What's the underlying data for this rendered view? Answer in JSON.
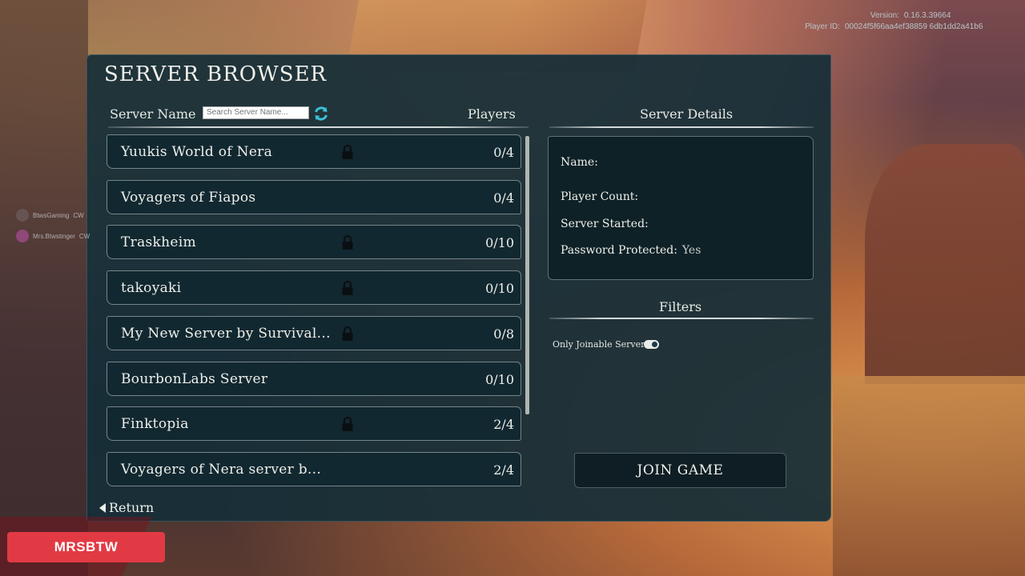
{
  "version": {
    "label": "Version:",
    "value": "0.16.3.39664",
    "player_label": "Player ID:",
    "player_value": "00024f5f66aa4ef38859 6db1dd2a41b6"
  },
  "title": "SERVER BROWSER",
  "list_header": {
    "name": "Server Name",
    "search_placeholder": "Search Server Name...",
    "players": "Players"
  },
  "servers": [
    {
      "name": "Yuukis World of Nera",
      "players": "0/4",
      "locked": true
    },
    {
      "name": "Voyagers of Fiapos",
      "players": "0/4",
      "locked": false
    },
    {
      "name": "Traskheim",
      "players": "0/10",
      "locked": true
    },
    {
      "name": "takoyaki",
      "players": "0/10",
      "locked": true
    },
    {
      "name": "My New Server by Survival...",
      "players": "0/8",
      "locked": true
    },
    {
      "name": "BourbonLabs Server",
      "players": "0/10",
      "locked": false
    },
    {
      "name": "Finktopia",
      "players": "2/4",
      "locked": true
    },
    {
      "name": "Voyagers of Nera server b...",
      "players": "2/4",
      "locked": false
    }
  ],
  "details": {
    "heading": "Server Details",
    "name_label": "Name:",
    "player_count_label": "Player Count:",
    "started_label": "Server Started:",
    "password_label": "Password Protected:",
    "password_value": "Yes"
  },
  "filters": {
    "heading": "Filters",
    "only_joinable": "Only Joinable Servers",
    "only_joinable_on": true
  },
  "join_button": "JOIN GAME",
  "return_label": "Return",
  "overlay": {
    "user1": "BtwsGaming",
    "user2": "Mrs.Btwstinger",
    "tag": "CW",
    "badge": "MRSBTW"
  },
  "colors": {
    "panel": "#162e38",
    "badge": "#e23a44",
    "text": "#eef0ea"
  }
}
